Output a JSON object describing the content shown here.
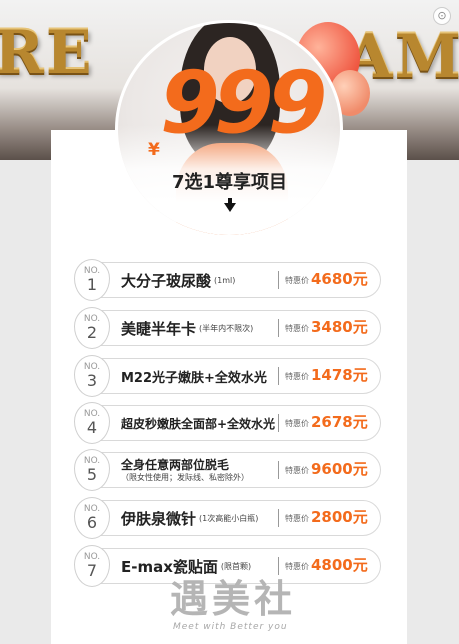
{
  "banner": {
    "balloon_left": "RE",
    "balloon_right": "SAM"
  },
  "hero": {
    "currency": "¥",
    "price": "999",
    "subtitle": "7选1尊享项目"
  },
  "items": [
    {
      "no_label": "NO.",
      "no": "1",
      "name": "大分子玻尿酸",
      "note": "(1ml)",
      "tag": "特惠价",
      "price": "4680元"
    },
    {
      "no_label": "NO.",
      "no": "2",
      "name": "美睫半年卡",
      "note": "(半年内不限次)",
      "tag": "特惠价",
      "price": "3480元"
    },
    {
      "no_label": "NO.",
      "no": "3",
      "name": "M22光子嫩肤+全效水光",
      "note": "",
      "tag": "特惠价",
      "price": "1478元"
    },
    {
      "no_label": "NO.",
      "no": "4",
      "name": "超皮秒嫩肤全面部+全效水光",
      "note": "",
      "tag": "特惠价",
      "price": "2678元"
    },
    {
      "no_label": "NO.",
      "no": "5",
      "name": "全身任意两部位脱毛",
      "note": "（限女性使用；发际线、私密除外）",
      "tag": "特惠价",
      "price": "9600元"
    },
    {
      "no_label": "NO.",
      "no": "6",
      "name": "伊肤泉微针",
      "note": "(1次高能小白瓶)",
      "tag": "特惠价",
      "price": "2800元"
    },
    {
      "no_label": "NO.",
      "no": "7",
      "name": "E-max瓷贴面",
      "note": "(限首颗)",
      "tag": "特惠价",
      "price": "4800元"
    }
  ],
  "watermark": {
    "logo": "遇美社",
    "slogan": "Meet with Better you"
  }
}
